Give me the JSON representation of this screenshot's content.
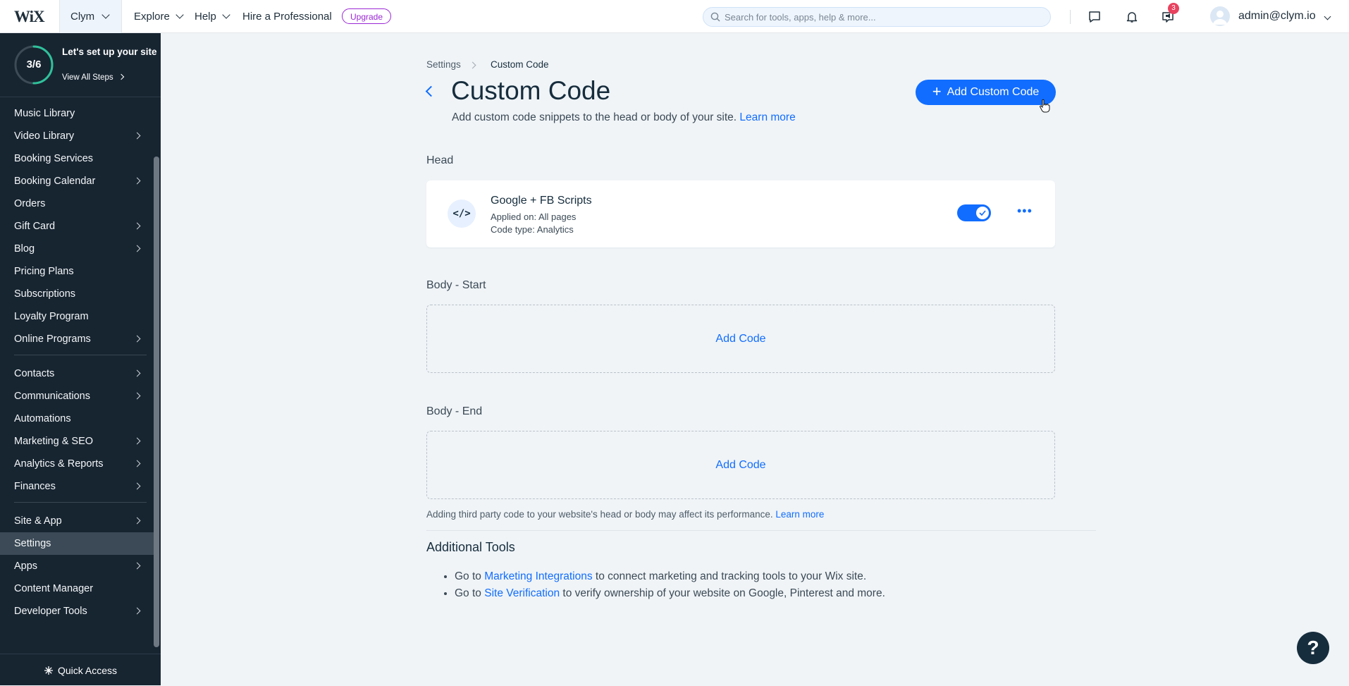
{
  "topbar": {
    "logo": "WiX",
    "site_name": "Clym",
    "nav": {
      "explore": "Explore",
      "help": "Help",
      "hire": "Hire a Professional"
    },
    "upgrade_label": "Upgrade",
    "search_placeholder": "Search for tools, apps, help & more...",
    "notification_count": "3",
    "user_email": "admin@clym.io"
  },
  "sidebar": {
    "setup": {
      "progress": "3/6",
      "progress_fraction": 0.5,
      "title": "Let's set up your site",
      "link": "View All Steps"
    },
    "items": [
      {
        "label": "Music Library"
      },
      {
        "label": "Video Library"
      },
      {
        "label": "Booking Services"
      },
      {
        "label": "Booking Calendar"
      },
      {
        "label": "Orders"
      },
      {
        "label": "Gift Card"
      },
      {
        "label": "Blog"
      },
      {
        "label": "Pricing Plans"
      },
      {
        "label": "Subscriptions"
      },
      {
        "label": "Loyalty Program"
      },
      {
        "label": "Online Programs"
      },
      {
        "label": "Contacts"
      },
      {
        "label": "Communications"
      },
      {
        "label": "Automations"
      },
      {
        "label": "Marketing & SEO"
      },
      {
        "label": "Analytics & Reports"
      },
      {
        "label": "Finances"
      },
      {
        "label": "Site & App"
      },
      {
        "label": "Settings"
      },
      {
        "label": "Apps"
      },
      {
        "label": "Content Manager"
      },
      {
        "label": "Developer Tools"
      }
    ],
    "quick_access": "Quick Access"
  },
  "main": {
    "breadcrumb": {
      "parent": "Settings",
      "current": "Custom Code"
    },
    "title": "Custom Code",
    "subtitle": "Add custom code snippets to the head or body of your site.",
    "learn_more": "Learn more",
    "add_button": "Add Custom Code",
    "sections": {
      "head": "Head",
      "body_start": "Body - Start",
      "body_end": "Body - End"
    },
    "snippet": {
      "name": "Google + FB Scripts",
      "applied_on": "Applied on: All pages",
      "code_type": "Code type: Analytics",
      "enabled": true
    },
    "add_code_label": "Add Code",
    "note": "Adding third party code to your website's head or body may affect its performance.",
    "note_link": "Learn more",
    "additional_tools": {
      "title": "Additional Tools",
      "go_to": "Go to",
      "items": [
        {
          "link": "Marketing Integrations",
          "text": "to connect marketing and tracking tools to your Wix site."
        },
        {
          "link": "Site Verification",
          "text": "to verify ownership of your website on Google, Pinterest and more."
        }
      ]
    },
    "help_label": "?"
  }
}
